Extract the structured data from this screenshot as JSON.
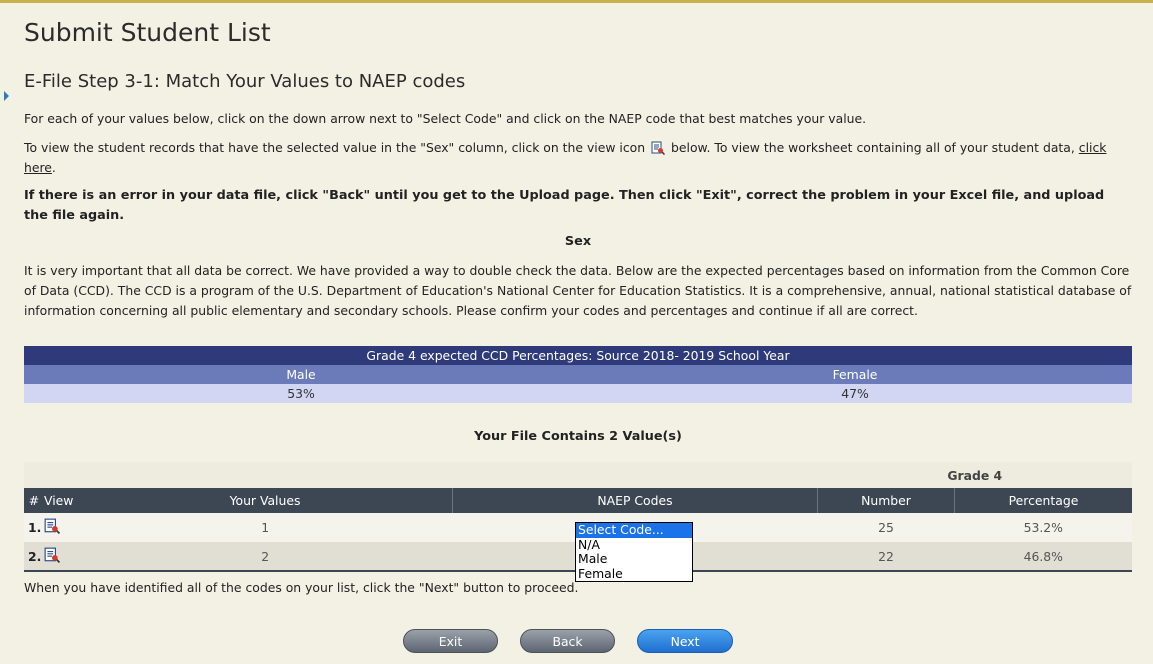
{
  "header": {
    "title": "Submit Student List",
    "step_title": "E-File Step 3-1: Match Your Values to NAEP codes"
  },
  "instructions": {
    "p1": "For each of your values below, click on the down arrow next to \"Select Code\" and click on the NAEP code that best matches your value.",
    "p2_before": "To view the student records that have the selected value in the \"Sex\" column, click on the view icon",
    "p2_after": "below. To view the worksheet containing all of your student data,",
    "p2_link": "click here",
    "p2_end": ".",
    "error_note": "If there is an error in your data file, click \"Back\" until you get to the Upload page. Then click \"Exit\", correct the problem in your Excel file, and upload the file again."
  },
  "section_heading": "Sex",
  "ccd_paragraph": "It is very important that all data be correct. We have provided a way to double check the data. Below are the expected percentages based on information from the Common Core of Data (CCD). The CCD is a program of the U.S. Department of Education's National Center for Education Statistics. It is a comprehensive, annual, national statistical database of information concerning all public elementary and secondary schools. Please confirm your codes and percentages and continue if all are correct.",
  "ccd_table": {
    "title": "Grade 4 expected CCD Percentages: Source 2018- 2019 School Year",
    "headers": [
      "Male",
      "Female"
    ],
    "values": [
      "53%",
      "47%"
    ]
  },
  "file_summary": "Your File Contains 2 Value(s)",
  "values_table": {
    "group_header": "Grade 4",
    "columns": [
      "#",
      "View",
      "Your Values",
      "NAEP Codes",
      "Number",
      "Percentage"
    ],
    "rows": [
      {
        "index": "1.",
        "value": "1",
        "number": "25",
        "percentage": "53.2%"
      },
      {
        "index": "2.",
        "value": "2",
        "number": "22",
        "percentage": "46.8%"
      }
    ]
  },
  "dropdown": {
    "selected": "Select Code...",
    "options": [
      "N/A",
      "Male",
      "Female"
    ]
  },
  "footer_note": "When you have identified all of the codes on your list, click the \"Next\" button to proceed.",
  "buttons": {
    "exit": "Exit",
    "back": "Back",
    "next": "Next"
  },
  "colors": {
    "background": "#f3f1e4",
    "ccd_title_bg": "#2f3a7a",
    "ccd_header_bg": "#6b7ab8",
    "ccd_value_bg": "#d3d6f2",
    "table_header_bg": "#3d4754",
    "next_button": "#1f6fd0",
    "grey_button": "#5d6570",
    "accent_line": "#c9b24b"
  },
  "icons": {
    "view": "view-record-icon",
    "marker": "blue-arrow-marker-icon"
  }
}
